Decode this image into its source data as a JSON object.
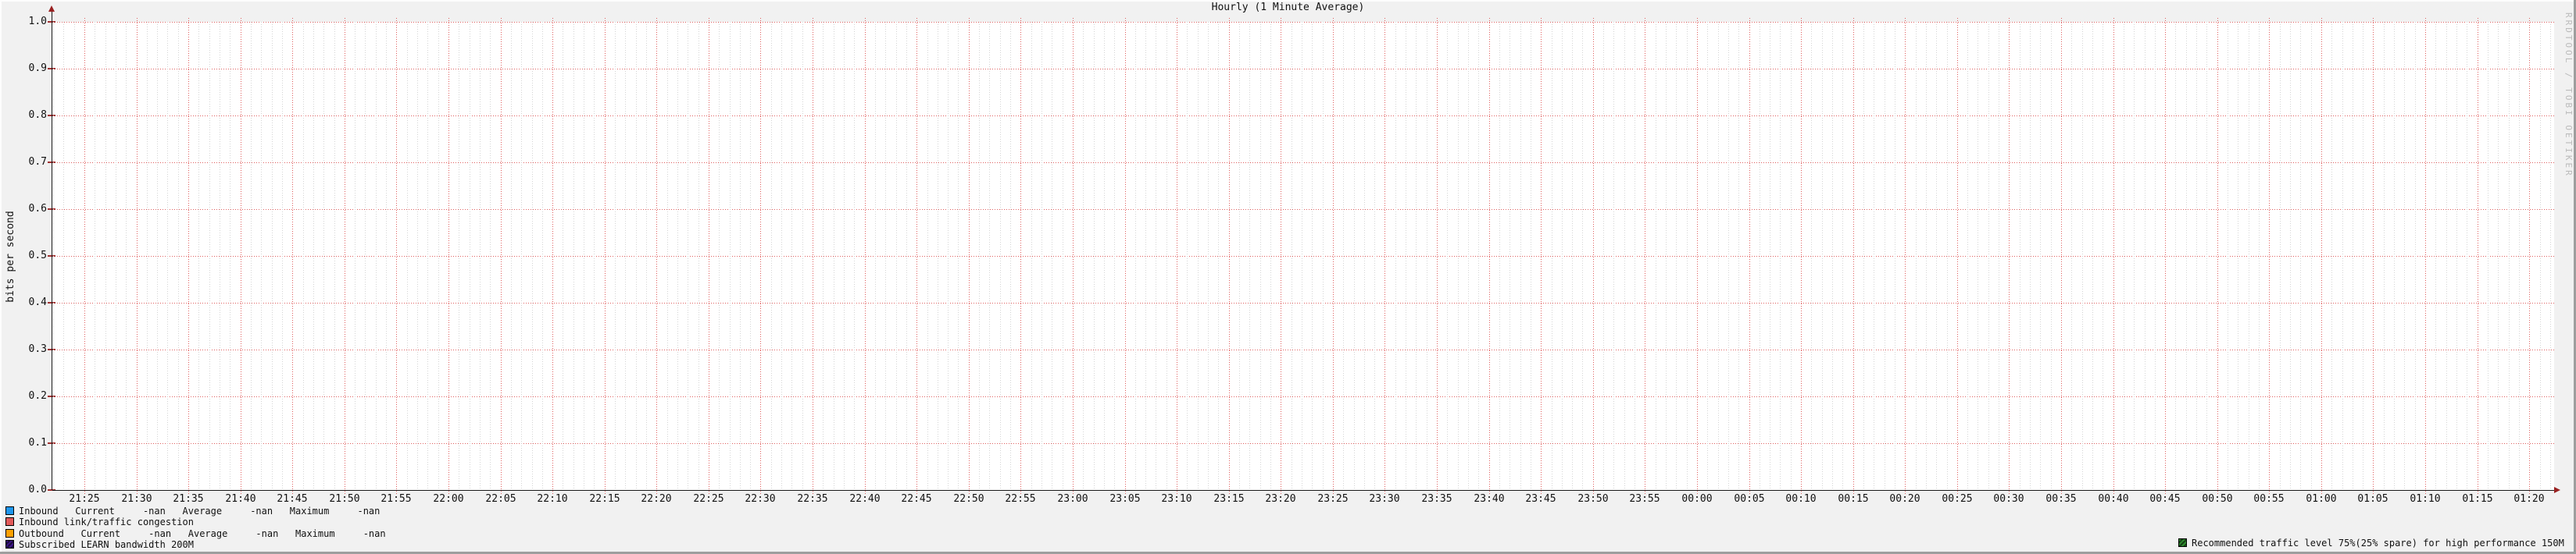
{
  "chart_data": {
    "type": "line",
    "title": "Hourly (1 Minute Average)",
    "ylabel": "bits per second",
    "ylim": [
      0.0,
      1.0
    ],
    "grid": true,
    "y_tick_labels": [
      "1.0",
      "0.9",
      "0.8",
      "0.7",
      "0.6",
      "0.5",
      "0.4",
      "0.3",
      "0.2",
      "0.1",
      "0.0"
    ],
    "x_tick_labels": [
      "21:25",
      "21:30",
      "21:35",
      "21:40",
      "21:45",
      "21:50",
      "21:55",
      "22:00",
      "22:05",
      "22:10",
      "22:15",
      "22:20",
      "22:25",
      "22:30",
      "22:35",
      "22:40",
      "22:45",
      "22:50",
      "22:55",
      "23:00",
      "23:05",
      "23:10",
      "23:15",
      "23:20",
      "23:25",
      "23:30",
      "23:35",
      "23:40",
      "23:45",
      "23:50",
      "23:55",
      "00:00",
      "00:05",
      "00:10",
      "00:15",
      "00:20",
      "00:25",
      "00:30",
      "00:35",
      "00:40",
      "00:45",
      "00:50",
      "00:55",
      "01:00",
      "01:05",
      "01:10",
      "01:15",
      "01:20"
    ],
    "x_minor_ticks_per_label": 5,
    "series": [
      {
        "name": "Inbound",
        "color": "#1f97ee",
        "current": "-nan",
        "average": "-nan",
        "maximum": "-nan",
        "values": []
      },
      {
        "name": "Inbound link/traffic congestion",
        "color": "#e25a5a",
        "values": []
      },
      {
        "name": "Outbound",
        "color": "#ffa000",
        "current": "-nan",
        "average": "-nan",
        "maximum": "-nan",
        "values": []
      },
      {
        "name": "Subscribed LEARN bandwidth 200M",
        "color": "#3c1488",
        "values": []
      }
    ],
    "annotations": [
      {
        "label": "Recommended traffic level 75%(25% spare) for high performance 150M",
        "color": "#2e8b2e"
      }
    ]
  },
  "legend": {
    "rows": [
      {
        "swatch_color": "#1f97ee",
        "hatched": false,
        "text": "Inbound   Current     -nan   Average     -nan   Maximum     -nan"
      },
      {
        "swatch_color": "#e25a5a",
        "hatched": false,
        "text": "Inbound link/traffic congestion"
      },
      {
        "swatch_color": "#ffa000",
        "hatched": false,
        "text": "Outbound   Current     -nan   Average     -nan   Maximum     -nan"
      },
      {
        "swatch_color": "#3c1488",
        "hatched": true,
        "text": "Subscribed LEARN bandwidth 200M"
      }
    ],
    "note": {
      "swatch_color": "#2e8b2e",
      "hatched": true,
      "text": "Recommended traffic level 75%(25% spare) for high performance 150M"
    }
  },
  "watermark": "RRDTOOL / TOBI OETIKER"
}
